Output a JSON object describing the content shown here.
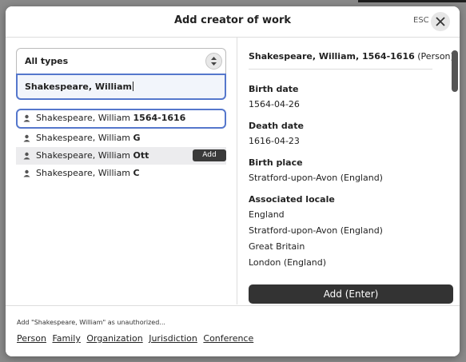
{
  "header": {
    "title": "Add creator of work",
    "esc_label": "ESC",
    "close_icon": "close-icon"
  },
  "type_select": {
    "value": "All types",
    "icon": "stepper-updown-icon"
  },
  "search": {
    "value": "Shakespeare, William"
  },
  "results": [
    {
      "prefix": "Shakespeare, William ",
      "suffix": "1564-1616",
      "icon": "person-icon"
    },
    {
      "prefix": "Shakespeare, William ",
      "suffix": "G",
      "icon": "person-icon"
    },
    {
      "prefix": "Shakespeare, William ",
      "suffix": "Ott",
      "icon": "person-icon",
      "action": "Add"
    },
    {
      "prefix": "Shakespeare, William ",
      "suffix": "C",
      "icon": "person-icon"
    }
  ],
  "detail": {
    "name": "Shakespeare, William, 1564-1616",
    "type": " (Person)",
    "birth_date": {
      "label": "Birth date",
      "value": "1564-04-26"
    },
    "death_date": {
      "label": "Death date",
      "value": "1616-04-23"
    },
    "birth_place": {
      "label": "Birth place",
      "value": "Stratford-upon-Avon (England)"
    },
    "locale": {
      "label": "Associated locale",
      "values": [
        "England",
        "Stratford-upon-Avon (England)",
        "Great Britain",
        "London (England)"
      ]
    },
    "add_button": "Add (Enter)"
  },
  "footer": {
    "hint": "Add \"Shakespeare, William\" as unauthorized...",
    "links": [
      "Person",
      "Family",
      "Organization",
      "Jurisdiction",
      "Conference"
    ]
  }
}
